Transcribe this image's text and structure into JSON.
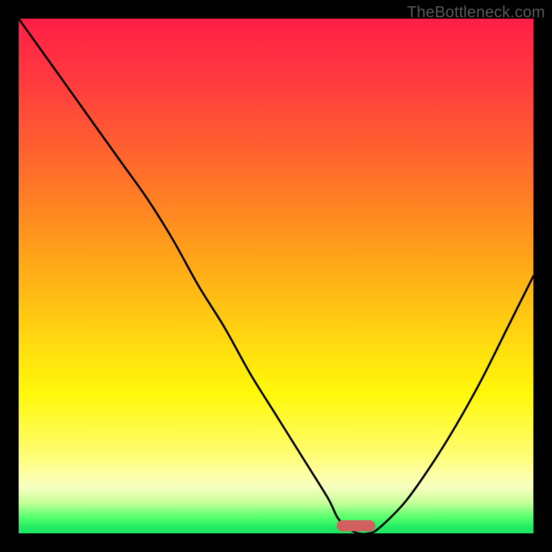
{
  "watermark": "TheBottleneck.com",
  "marker": {
    "x_frac": 0.655,
    "y_frac": 0.985
  },
  "chart_data": {
    "type": "line",
    "title": "",
    "xlabel": "",
    "ylabel": "",
    "xlim": [
      0,
      100
    ],
    "ylim": [
      0,
      100
    ],
    "series": [
      {
        "name": "bottleneck-curve",
        "x": [
          0,
          5,
          10,
          15,
          20,
          25,
          30,
          35,
          40,
          45,
          50,
          55,
          60,
          62,
          64,
          66,
          68,
          70,
          75,
          80,
          85,
          90,
          95,
          100
        ],
        "values": [
          100,
          93,
          86,
          79,
          72,
          65,
          57,
          48,
          40,
          31,
          23,
          15,
          7,
          3,
          1,
          0,
          0,
          1,
          6,
          13,
          21,
          30,
          40,
          50
        ]
      }
    ],
    "optimum_marker": {
      "x": 66,
      "y": 0
    },
    "background_gradient": {
      "top_color": "#FF1E46",
      "bottom_color": "#1FE864"
    }
  }
}
